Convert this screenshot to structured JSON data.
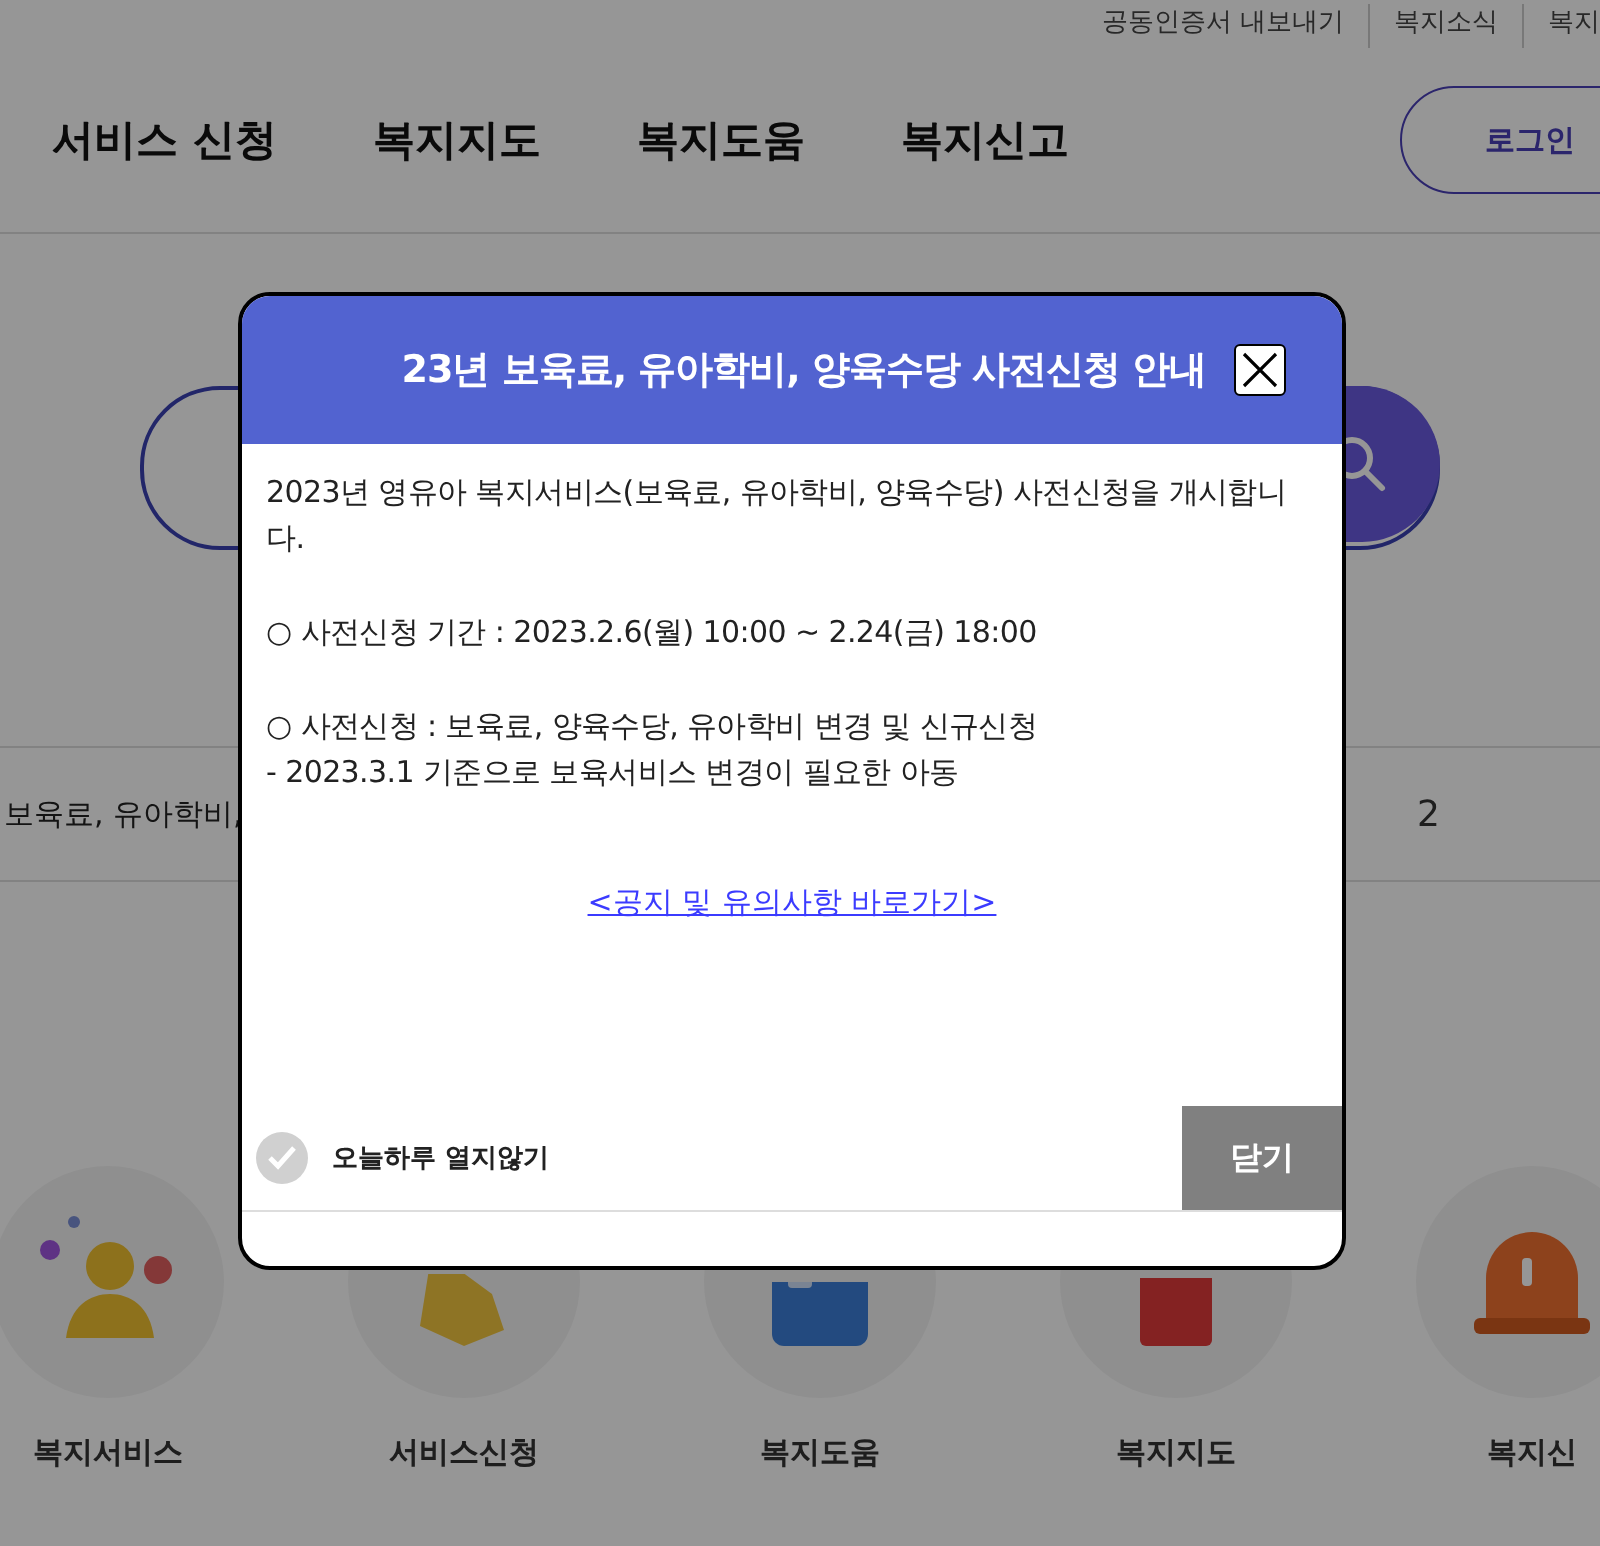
{
  "top_links": [
    "공동인증서 내보내기",
    "복지소식",
    "복지"
  ],
  "nav": {
    "items": [
      "서비스 신청",
      "복지지도",
      "복지도움",
      "복지신고"
    ],
    "login": "로그인"
  },
  "notice_row": {
    "text": "보육료, 유아학비,",
    "count": "2"
  },
  "quick_menu": [
    {
      "label": "복지서비스",
      "kind": "person"
    },
    {
      "label": "서비스신청",
      "kind": "hand"
    },
    {
      "label": "복지도움",
      "kind": "doc"
    },
    {
      "label": "복지지도",
      "kind": "building"
    },
    {
      "label": "복지신",
      "kind": "siren"
    }
  ],
  "modal": {
    "title": "23년 보육료, 유아학비, 양육수당 사전신청 안내",
    "paragraphs": [
      "2023년 영유아 복지서비스(보육료, 유아학비, 양육수당) 사전신청을 개시합니다.",
      "○ 사전신청 기간 : 2023.2.6(월) 10:00 ~ 2.24(금) 18:00",
      "○ 사전신청 : 보육료, 양육수당, 유아학비 변경 및 신규신청\n- 2023.3.1 기준으로 보육서비스 변경이 필요한 아동"
    ],
    "link": "<공지 및 유의사항 바로가기>",
    "dont_show_today": {
      "label": "오늘하루 열지않기",
      "checked": false
    },
    "close_button": "닫기"
  }
}
